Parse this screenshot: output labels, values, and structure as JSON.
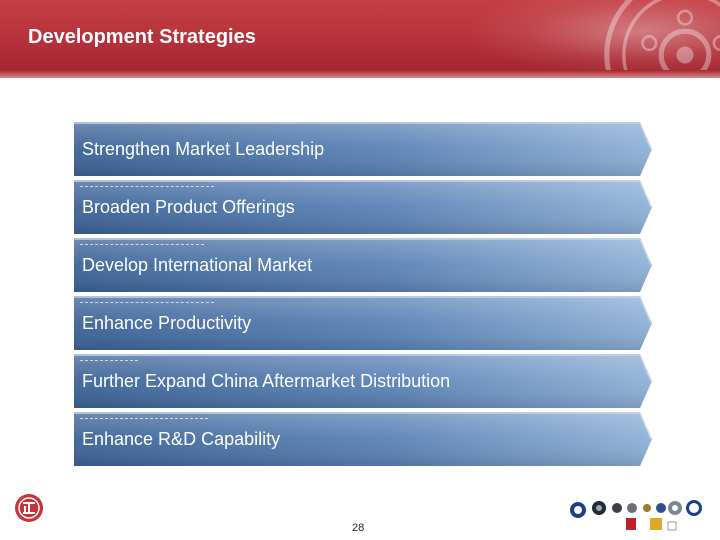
{
  "slide": {
    "title": "Development Strategies",
    "page_number": "28"
  },
  "colors": {
    "header_red": "#b5303a",
    "band_blue_dark": "#3c6397",
    "band_blue_light": "#8fb0d6"
  },
  "strategies": [
    {
      "label": "Strengthen Market Leadership"
    },
    {
      "label": "Broaden Product Offerings"
    },
    {
      "label": "Develop International Market"
    },
    {
      "label": "Enhance Productivity"
    },
    {
      "label": "Further Expand China Aftermarket Distribution"
    },
    {
      "label": "Enhance R&D Capability"
    }
  ],
  "icons": {
    "watermark": "wheel-icon",
    "left_logo": "company-logo-icon",
    "brand_strip": "brand-logos-icon"
  }
}
